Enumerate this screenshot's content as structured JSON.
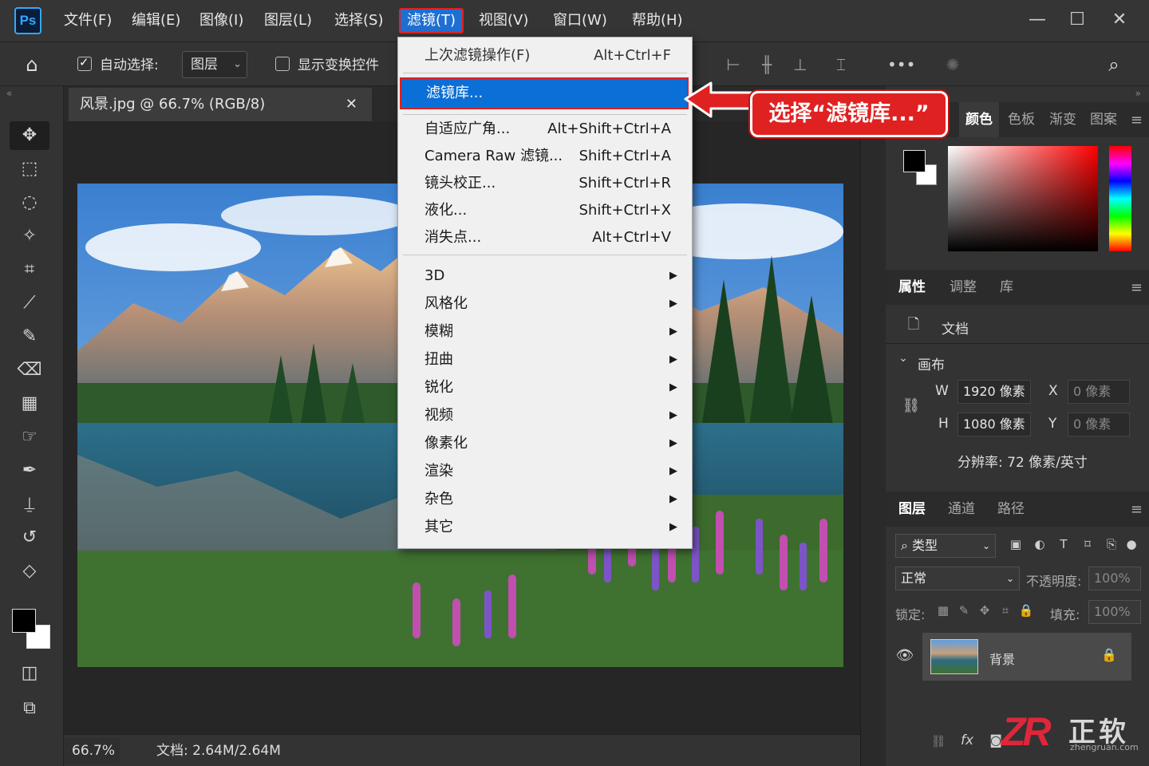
{
  "app": {
    "logo": "Ps"
  },
  "menubar": {
    "items": [
      {
        "label": "文件(F)"
      },
      {
        "label": "编辑(E)"
      },
      {
        "label": "图像(I)"
      },
      {
        "label": "图层(L)"
      },
      {
        "label": "选择(S)"
      },
      {
        "label": "滤镜(T)"
      },
      {
        "label": "视图(V)"
      },
      {
        "label": "窗口(W)"
      },
      {
        "label": "帮助(H)"
      }
    ],
    "active": "滤镜(T)"
  },
  "optionsbar": {
    "auto_select_label": "自动选择:",
    "auto_select_checked": true,
    "auto_select_target": "图层",
    "show_transform_label": "显示变换控件",
    "show_transform_checked": false
  },
  "document": {
    "tab_title": "风景.jpg  @ 66.7%  (RGB/8)",
    "close_glyph": "✕",
    "zoom": "66.7%",
    "doc_size": "文档: 2.64M/2.64M"
  },
  "filter_menu": {
    "last_filter": {
      "label": "上次滤镜操作(F)",
      "shortcut": "Alt+Ctrl+F"
    },
    "filter_gallery": {
      "label": "滤镜库..."
    },
    "items": [
      {
        "label": "自适应广角...",
        "shortcut": "Alt+Shift+Ctrl+A"
      },
      {
        "label": "Camera Raw 滤镜...",
        "shortcut": "Shift+Ctrl+A"
      },
      {
        "label": "镜头校正...",
        "shortcut": "Shift+Ctrl+R"
      },
      {
        "label": "液化...",
        "shortcut": "Shift+Ctrl+X"
      },
      {
        "label": "消失点...",
        "shortcut": "Alt+Ctrl+V"
      }
    ],
    "submenus": [
      {
        "label": "3D"
      },
      {
        "label": "风格化"
      },
      {
        "label": "模糊"
      },
      {
        "label": "扭曲"
      },
      {
        "label": "锐化"
      },
      {
        "label": "视频"
      },
      {
        "label": "像素化"
      },
      {
        "label": "渲染"
      },
      {
        "label": "杂色"
      },
      {
        "label": "其它"
      }
    ]
  },
  "callout": {
    "text": "选择“滤镜库...”",
    "color": "#e02121"
  },
  "color_panel": {
    "tabs": [
      {
        "label": "颜色"
      },
      {
        "label": "色板"
      },
      {
        "label": "渐变"
      },
      {
        "label": "图案"
      }
    ],
    "foreground": "#000000",
    "background": "#ffffff",
    "hue": "#ff0000"
  },
  "properties_panel": {
    "tabs": [
      {
        "label": "属性"
      },
      {
        "label": "调整"
      },
      {
        "label": "库"
      }
    ],
    "doc_label": "文档",
    "canvas_label": "画布",
    "w_label": "W",
    "h_label": "H",
    "x_label": "X",
    "y_label": "Y",
    "width": "1920 像素",
    "height": "1080 像素",
    "x": "0 像素",
    "y": "0 像素",
    "resolution": "分辨率: 72 像素/英寸"
  },
  "layers_panel": {
    "tabs": [
      {
        "label": "图层"
      },
      {
        "label": "通道"
      },
      {
        "label": "路径"
      }
    ],
    "filter_kind": "类型",
    "blend_mode": "正常",
    "opacity_label": "不透明度:",
    "opacity": "100%",
    "lock_label": "锁定:",
    "fill_label": "填充:",
    "fill": "100%",
    "layers": [
      {
        "name": "背景",
        "locked": true,
        "visible": true
      }
    ]
  },
  "watermark": {
    "logo": "ZR",
    "name": "正软",
    "url": "zhengruan.com"
  },
  "colors": {
    "accent": "#1e6fd1",
    "highlight_border": "#e02020",
    "panel_bg": "#333333"
  }
}
